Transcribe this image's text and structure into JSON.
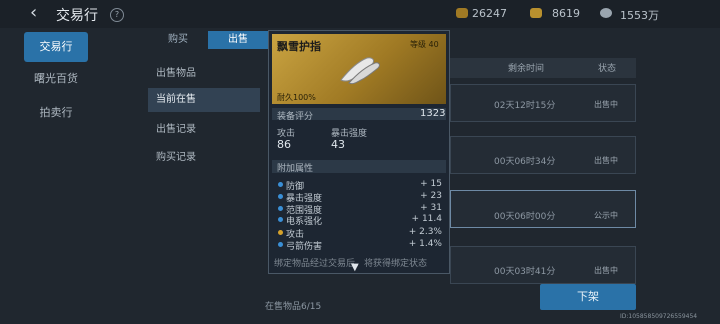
{
  "header": {
    "title": "交易行",
    "help": "?",
    "currencies": [
      {
        "icon": "gold-shield-icon",
        "value": "26247"
      },
      {
        "icon": "coin-pile-icon",
        "value": "8619"
      },
      {
        "icon": "silver-coin-icon",
        "value": "1553万"
      }
    ]
  },
  "nav": [
    "交易行",
    "曙光百货",
    "拍卖行"
  ],
  "tabs": {
    "buy": "购买",
    "sell": "出售"
  },
  "submenu": [
    "出售物品",
    "当前在售",
    "出售记录",
    "购买记录"
  ],
  "table": {
    "columns": [
      "剩余时间",
      "状态"
    ],
    "rows": [
      {
        "time": "02天12时15分",
        "status": "出售中"
      },
      {
        "time": "00天06时34分",
        "status": "出售中"
      },
      {
        "time": "00天06时00分",
        "status": "公示中"
      },
      {
        "time": "00天03时41分",
        "status": "出售中"
      }
    ]
  },
  "footer": {
    "count": "在售物品6/15",
    "button": "下架",
    "uid": "ID:105858509726559454"
  },
  "tooltip": {
    "name": "飘雪护指",
    "level": "等级 40",
    "durability": "耐久100%",
    "score_label": "装备评分",
    "score": "1323",
    "stats": [
      {
        "label": "攻击",
        "value": "86"
      },
      {
        "label": "暴击强度",
        "value": "43"
      }
    ],
    "attr_header": "附加属性",
    "attrs": [
      {
        "name": "防御",
        "value": "+ 15",
        "dot": "blue"
      },
      {
        "name": "暴击强度",
        "value": "+ 23",
        "dot": "blue"
      },
      {
        "name": "范围强度",
        "value": "+ 31",
        "dot": "blue"
      },
      {
        "name": "电系强化",
        "value": "+ 11.4",
        "dot": "blue"
      },
      {
        "name": "攻击",
        "value": "+ 2.3%",
        "dot": "gold"
      },
      {
        "name": "弓箭伤害",
        "value": "+ 1.4%",
        "dot": "blue"
      }
    ],
    "cutoff_text": "绑定物品经过交易后，将获得绑定状态",
    "more_icon": "chevron-down-icon"
  },
  "colors": {
    "accent": "#2a72a8",
    "gold": "#caa442"
  }
}
